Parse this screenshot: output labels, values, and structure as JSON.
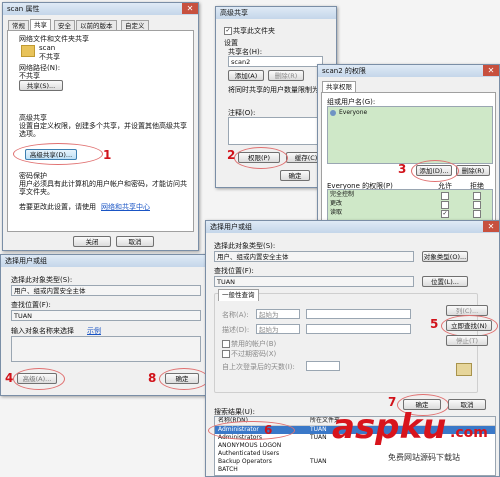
{
  "w1": {
    "title": "scan 属性",
    "tabs": [
      "常规",
      "共享",
      "安全",
      "以前的版本",
      "自定义"
    ],
    "sharing_header": "网络文件和文件夹共享",
    "folder_name": "scan",
    "folder_status": "不共享",
    "netpath_label": "网络路径(N):",
    "netpath_value": "不共享",
    "share_btn": "共享(S)...",
    "adv_header": "高级共享",
    "adv_desc": "设置自定义权限，创建多个共享，并设置其他高级共享选项。",
    "adv_btn": "高级共享(D)...",
    "pw_header": "密码保护",
    "pw_desc": "用户必须具有此计算机的用户帐户和密码，才能访问共享文件夹。",
    "pw_link_pre": "若要更改此设置，请使用",
    "pw_link": "网络和共享中心",
    "close_btn": "关闭",
    "cancel_btn": "取消"
  },
  "w2": {
    "title": "高级共享",
    "share_chk": "共享此文件夹",
    "settings": "设置",
    "share_name_label": "共享名(H):",
    "share_name": "scan2",
    "add_btn": "添加(A)",
    "remove_btn": "删除(R)",
    "limit": "将同时共享的用户数量限制为(L):",
    "note_label": "注释(O):",
    "perm_btn": "权限(P)",
    "cache_btn": "缓存(C)",
    "ok_btn": "确定"
  },
  "w3": {
    "title": "scan2 的权限",
    "tab": "共享权限",
    "group_label": "组或用户名(G):",
    "group_item": "Everyone",
    "add_btn": "添加(D)...",
    "remove_btn": "删除(R)",
    "perm_title": "Everyone 的权限(P)",
    "allow": "允许",
    "deny": "拒绝",
    "perms": [
      "完全控制",
      "更改",
      "读取"
    ]
  },
  "w4": {
    "title": "选择用户或组",
    "type_label": "选择此对象类型(S):",
    "type_value": "用户、组或内置安全主体",
    "loc_label": "查找位置(F):",
    "loc_value": "TUAN",
    "name_label": "输入对象名称来选择",
    "example": "示例",
    "adv_btn": "高级(A)...",
    "ok_btn": "确定"
  },
  "w5": {
    "title": "选择用户或组",
    "type_label": "选择此对象类型(S):",
    "type_value": "用户、组或内置安全主体",
    "type_btn": "对象类型(O)...",
    "loc_label": "查找位置(F):",
    "loc_value": "TUAN",
    "loc_btn": "位置(L)...",
    "query_tab": "一般性查询",
    "name_label": "名称(A):",
    "desc_label": "描述(D):",
    "starts_with": "起始为",
    "disabled": "禁用的帐户(B)",
    "no_expire": "不过期密码(X)",
    "days_label": "自上次登录后的天数(I):",
    "col_btn": "列(C)...",
    "find_btn": "立即查找(N)",
    "stop_btn": "停止(T)",
    "ok_btn": "确定",
    "cancel_btn": "取消",
    "results_label": "搜索结果(U):",
    "col_name": "名称(RDN)",
    "col_folder": "所在文件夹",
    "results": [
      {
        "name": "Administrator",
        "folder": "TUAN"
      },
      {
        "name": "Administrators",
        "folder": "TUAN"
      },
      {
        "name": "ANONYMOUS LOGON",
        "folder": ""
      },
      {
        "name": "Authenticated Users",
        "folder": ""
      },
      {
        "name": "Backup Operators",
        "folder": "TUAN"
      },
      {
        "name": "BATCH",
        "folder": ""
      }
    ]
  },
  "annotations": {
    "n1": "1",
    "n2": "2",
    "n3": "3",
    "n4": "4",
    "n5": "5",
    "n6": "6",
    "n7": "7",
    "n8": "8"
  },
  "watermark": {
    "logo": "aspku",
    "tld": ".com",
    "sub": "免费网站源码下载站"
  }
}
